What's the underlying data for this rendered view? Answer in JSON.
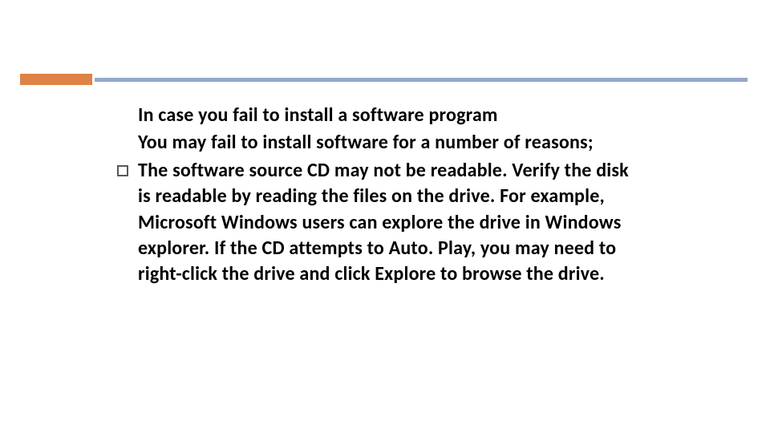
{
  "slide": {
    "heading": "In case you fail to install a software program",
    "intro": "You may fail to install software for a number of reasons;",
    "bullets": [
      "The software source CD may not be readable. Verify the disk is readable by reading the files on the drive. For example, Microsoft Windows users can explore the drive in Windows explorer. If the CD attempts to Auto. Play, you may need to right-click the drive and click Explore to browse the drive."
    ]
  }
}
